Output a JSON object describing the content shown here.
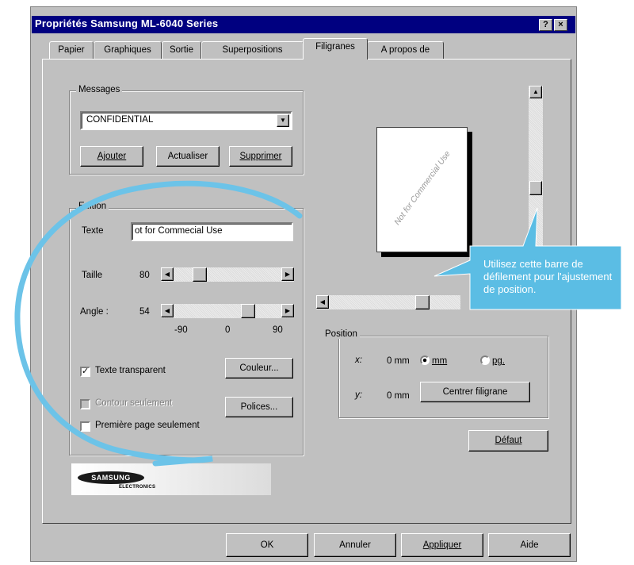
{
  "window": {
    "title": "Propriétés Samsung ML-6040 Series",
    "help_button": "?",
    "close_button": "×"
  },
  "tabs": [
    {
      "label": "Papier"
    },
    {
      "label": "Graphiques"
    },
    {
      "label": "Sortie"
    },
    {
      "label": "Superpositions"
    },
    {
      "label": "Filigranes",
      "active": true
    },
    {
      "label": "A propos de"
    }
  ],
  "messages": {
    "legend": "Messages",
    "selected": "CONFIDENTIAL",
    "add_label": "Ajouter",
    "update_label": "Actualiser",
    "delete_label": "Supprimer"
  },
  "edition": {
    "legend": "Edition",
    "text_label": "Texte",
    "text_value": "ot for Commecial Use",
    "size_label": "Taille",
    "size_value": "80",
    "angle_label": "Angle :",
    "angle_value": "54",
    "angle_ticks": [
      "-90",
      "0",
      "90"
    ],
    "transparent_label": "Texte transparent",
    "transparent_checked": true,
    "outline_label": "Contour seulement",
    "first_page_label": "Première page seulement",
    "first_page_checked": false,
    "color_button": "Couleur...",
    "font_button": "Polices..."
  },
  "preview": {
    "watermark_text": "Not for Commercial Use"
  },
  "position": {
    "legend": "Position",
    "x_label": "x:",
    "x_value": "0 mm",
    "y_label": "y:",
    "y_value": "0 mm",
    "unit_mm": "mm",
    "unit_pg": "pg.",
    "selected_unit": "mm",
    "center_button": "Centrer filigrane"
  },
  "default_button": "Défaut",
  "logo": {
    "brand": "SAMSUNG",
    "sub": "ELECTRONICS"
  },
  "footer": {
    "ok": "OK",
    "cancel": "Annuler",
    "apply": "Appliquer",
    "help": "Aide"
  },
  "callout": {
    "text": "Utilisez cette barre de défilement pour l'ajustement de position."
  },
  "colors": {
    "titlebar": "#000080",
    "dialog": "#c0c0c0",
    "callout": "#5bbde4",
    "circle": "#6cc3e8"
  }
}
